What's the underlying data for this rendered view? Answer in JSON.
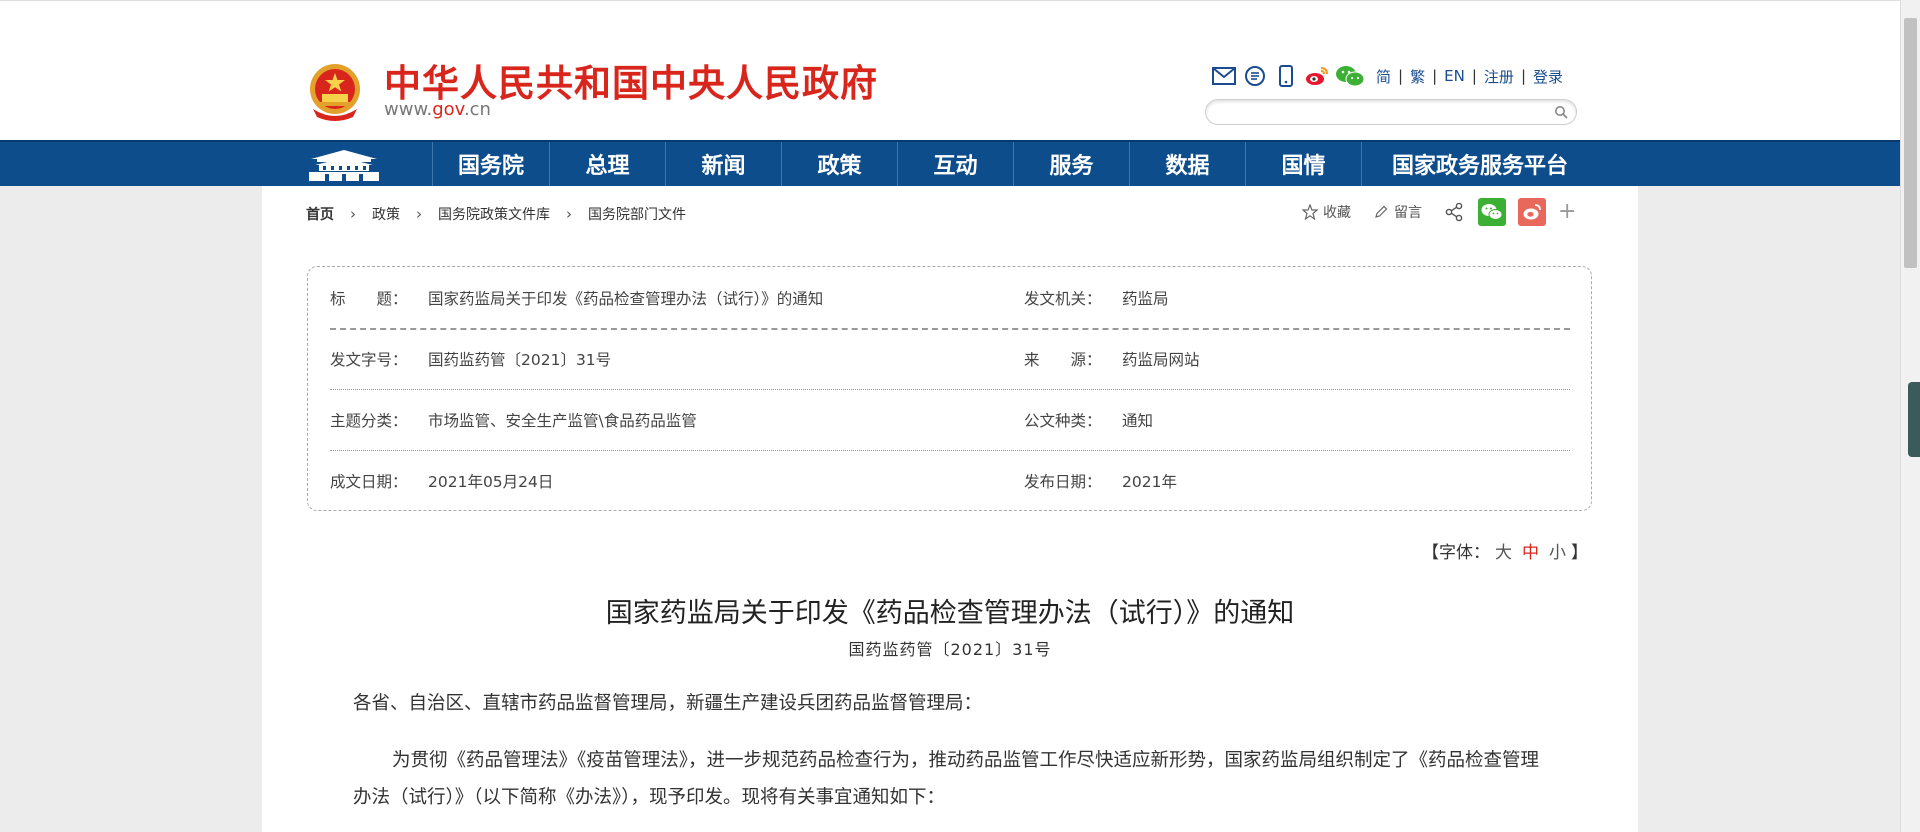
{
  "header": {
    "site_title": "中华人民共和国中央人民政府",
    "site_url_prefix": "www.",
    "site_url_domain": "gov",
    "site_url_suffix": ".cn",
    "lang_links": [
      "简",
      "繁",
      "EN",
      "注册",
      "登录"
    ],
    "search_placeholder": ""
  },
  "nav": {
    "items": [
      "国务院",
      "总理",
      "新闻",
      "政策",
      "互动",
      "服务",
      "数据",
      "国情",
      "国家政务服务平台"
    ]
  },
  "breadcrumb": [
    "首页",
    "政策",
    "国务院政策文件库",
    "国务院部门文件"
  ],
  "actions": {
    "favorite": "收藏",
    "comment": "留言"
  },
  "meta": {
    "rows": [
      {
        "label": "标　　题：",
        "value": "国家药监局关于印发《药品检查管理办法（试行）》的通知",
        "label2": "发文机关：",
        "value2": "药监局"
      },
      {
        "label": "发文字号：",
        "value": "国药监药管〔2021〕31号",
        "label2": "来　　源：",
        "value2": "药监局网站"
      },
      {
        "label": "主题分类：",
        "value": "市场监管、安全生产监管\\食品药品监管",
        "label2": "公文种类：",
        "value2": "通知"
      },
      {
        "label": "成文日期：",
        "value": "2021年05月24日",
        "label2": "发布日期：",
        "value2": "2021年"
      }
    ]
  },
  "font_size": {
    "prefix": "【字体：",
    "large": "大",
    "medium": "中",
    "small": "小",
    "suffix": "】"
  },
  "article": {
    "title": "国家药监局关于印发《药品检查管理办法（试行）》的通知",
    "doc_number": "国药监药管〔2021〕31号",
    "para1": "各省、自治区、直辖市药品监督管理局，新疆生产建设兵团药品监督管理局：",
    "para2": "为贯彻《药品管理法》《疫苗管理法》，进一步规范药品检查行为，推动药品监管工作尽快适应新形势，国家药监局组织制定了《药品检查管理办法（试行）》（以下简称《办法》），现予印发。现将有关事宜通知如下："
  },
  "colors": {
    "brand_red": "#d9261c",
    "nav_blue": "#0e4d8c",
    "wechat_green": "#3cb034",
    "weibo_red": "#e8695b"
  },
  "icons": [
    "national-emblem-icon",
    "mail-icon",
    "message-icon",
    "mobile-icon",
    "weibo-icon",
    "wechat-icon",
    "search-icon",
    "tiananmen-icon",
    "star-icon",
    "pencil-icon",
    "share-icon",
    "plus-icon"
  ]
}
